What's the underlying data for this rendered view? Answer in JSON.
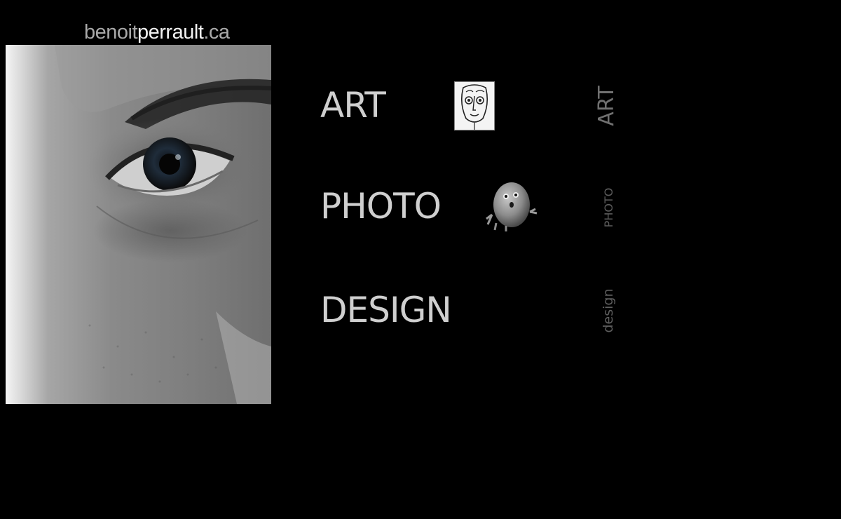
{
  "site_title": {
    "part1": "benoit",
    "part2": "perrault",
    "part3": ".ca"
  },
  "nav": {
    "art_label": "ART",
    "photo_label": "PHOTO",
    "design_label": "DESIGN"
  },
  "vertical_nav": {
    "art_label": "ART",
    "photo_label": "PHOTO",
    "design_label": "design"
  },
  "colors": {
    "background": "#000000",
    "nav_text": "#cfcfcf",
    "title_dim": "#a9a9a9",
    "title_bright": "#f2f2f2"
  }
}
